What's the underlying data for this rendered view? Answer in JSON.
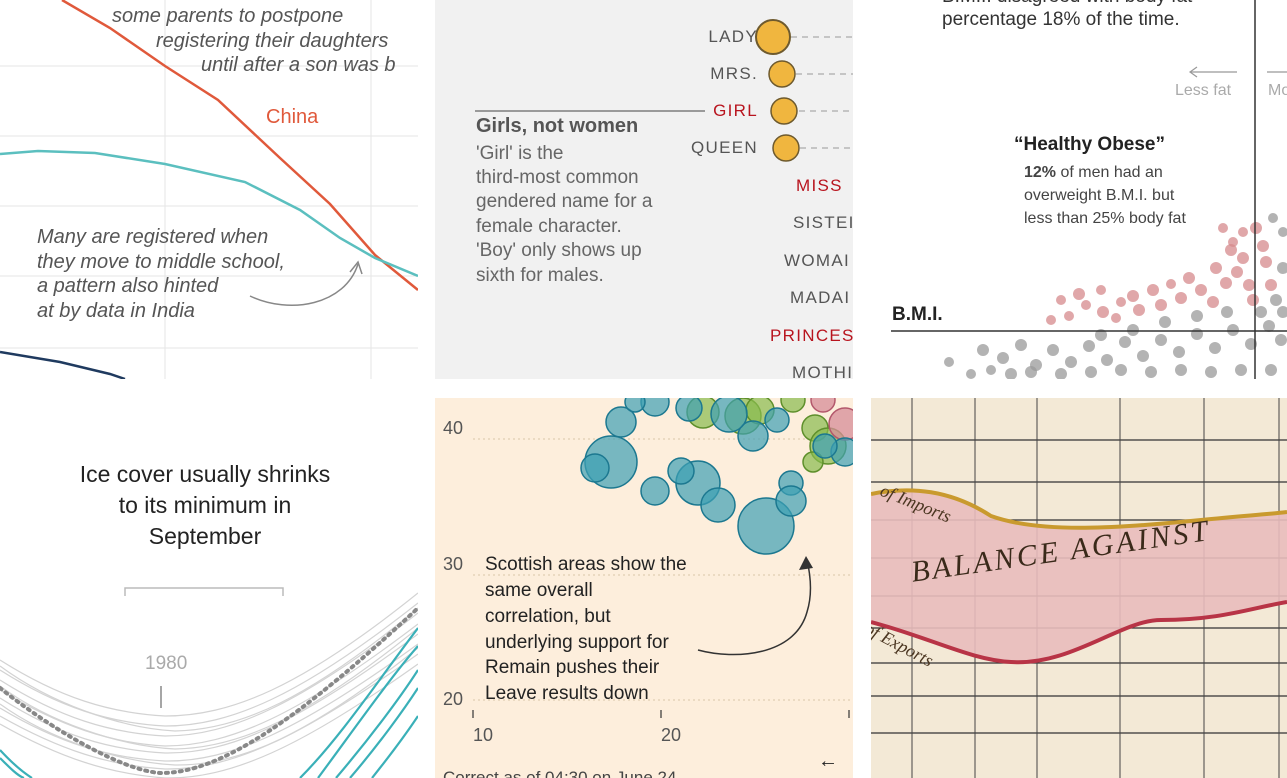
{
  "panels": {
    "china": {
      "note_top": [
        "some parents to postpone",
        "registering their daughters",
        "until after a son was b"
      ],
      "series_label": "China",
      "note_bottom": [
        "Many are registered when",
        "they move to middle school,",
        "a pattern also hinted",
        "at by data in India"
      ],
      "colors": {
        "china": "#e0593b",
        "india": "#5bbfbf",
        "other": "#1f3a5f",
        "grid": "#e6e6e6"
      }
    },
    "titles": {
      "ranked_labels": [
        {
          "label": "LADY",
          "highlight": false
        },
        {
          "label": "MRS.",
          "highlight": false
        },
        {
          "label": "GIRL",
          "highlight": true
        },
        {
          "label": "QUEEN",
          "highlight": false
        }
      ],
      "unranked_labels": [
        {
          "label": "MISS",
          "highlight": true
        },
        {
          "label": "SISTEI",
          "highlight": false
        },
        {
          "label": "WOMAI",
          "highlight": false
        },
        {
          "label": "MADAI",
          "highlight": false
        },
        {
          "label": "PRINCES",
          "highlight": true
        },
        {
          "label": "MOTHI",
          "highlight": false
        }
      ],
      "heading": "Girls, not women",
      "description": [
        "'Girl' is the",
        "third-most common",
        "gendered name for a",
        "female character.",
        "'Boy' only shows up",
        "sixth for males."
      ],
      "colors": {
        "dot": "#f0b63f",
        "dot_edge": "#6e5a2e",
        "highlight": "#b8141e"
      }
    },
    "bmi": {
      "top_text": [
        "B.M.I. disagreed with body fat",
        "percentage 18% of the time."
      ],
      "less_fat": "Less fat",
      "more_fat": "Mo",
      "heading": "“Healthy Obese”",
      "percent": "12%",
      "body": [
        " of men had an",
        "overweight B.M.I. but",
        "less than 25% body fat"
      ],
      "axis_label": "B.M.I.",
      "colors": {
        "dot_red": "#d58a8c",
        "dot_gray": "#9a9a9a"
      }
    },
    "ice": {
      "title": [
        "Ice cover usually shrinks",
        "to its minimum in",
        "September"
      ],
      "year_label": "1980",
      "colors": {
        "teal": "#3ab0b8",
        "gray": "#d3d3d3",
        "dotted": "#888888"
      }
    },
    "brexit": {
      "note": [
        "Scottish areas show the",
        "same overall",
        "correlation, but",
        "underlying support for",
        "Remain pushes their",
        "Leave results down"
      ],
      "chart_data": {
        "type": "scatter",
        "x": [
          10,
          20
        ],
        "y": [
          20,
          30,
          40
        ]
      },
      "footer": "Correct as of 04:30 on June 24",
      "arrow_text": "←",
      "colors": {
        "teal": "#3d9fb3",
        "green": "#88bb4d",
        "pink": "#d68c98"
      }
    },
    "playfair": {
      "label_imports": "of Imports",
      "label_balance": "BALANCE AGAINST",
      "label_exports": "of Exports",
      "colors": {
        "fill": "#e9bcbc",
        "gold": "#c99a2e",
        "red": "#b83446"
      }
    }
  }
}
